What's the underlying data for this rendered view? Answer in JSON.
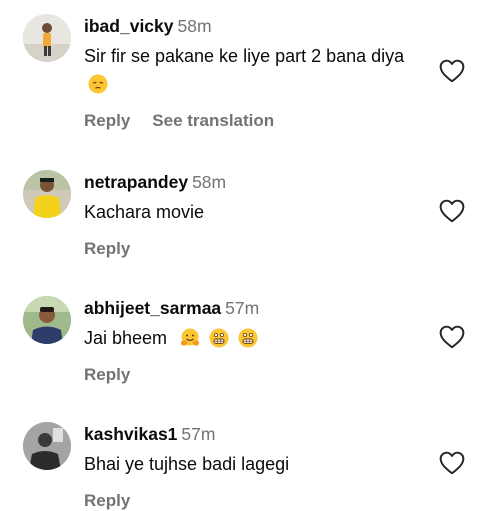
{
  "comments": [
    {
      "username": "ibad_vicky",
      "time": "58m",
      "text": "Sir fir se pakane ke liye part 2 bana diya",
      "emojis": [
        "pensive-face"
      ],
      "reply": "Reply",
      "translate": "See translation"
    },
    {
      "username": "netrapandey",
      "time": "58m",
      "text": "Kachara movie",
      "emojis": [],
      "reply": "Reply"
    },
    {
      "username": "abhijeet_sarmaa",
      "time": "57m",
      "text": "Jai bheem",
      "emojis": [
        "hugging-face",
        "grimacing-face",
        "grimacing-face"
      ],
      "reply": "Reply"
    },
    {
      "username": "kashvikas1",
      "time": "57m",
      "text": "Bhai ye tujhse badi lagegi",
      "emojis": [],
      "reply": "Reply"
    }
  ],
  "icons": {
    "like": "heart-outline-icon"
  },
  "colors": {
    "text": "#0b0b0b",
    "muted": "#737373",
    "background": "#ffffff"
  }
}
